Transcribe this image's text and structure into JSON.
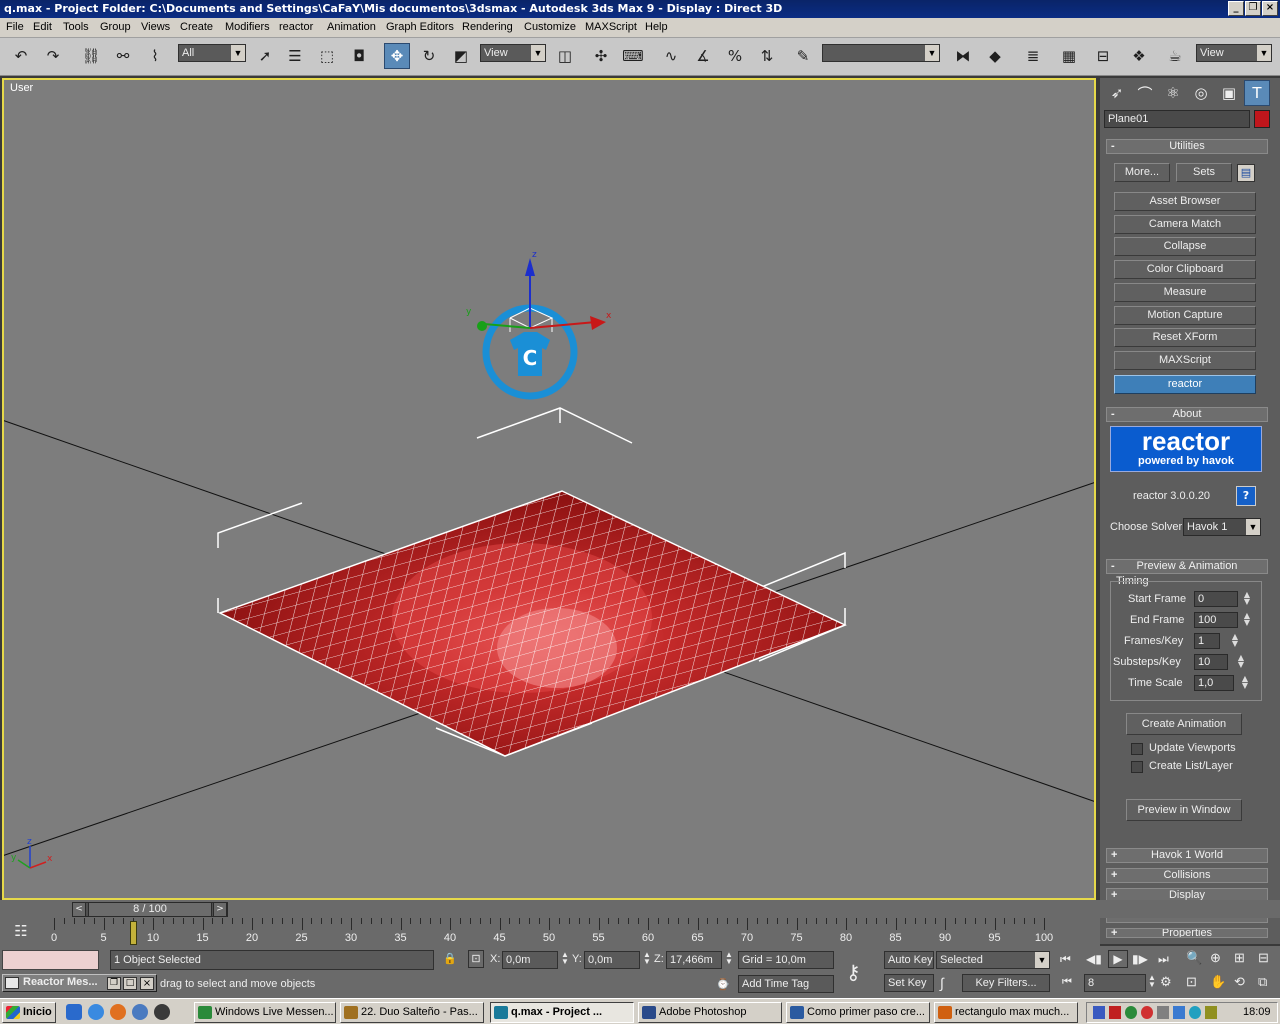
{
  "window": {
    "title": "q.max     - Project Folder: C:\\Documents and Settings\\CaFaY\\Mis documentos\\3dsmax     - Autodesk 3ds Max 9     - Display : Direct 3D"
  },
  "menu": [
    "File",
    "Edit",
    "Tools",
    "Group",
    "Views",
    "Create",
    "Modifiers",
    "reactor",
    "Animation",
    "Graph Editors",
    "Rendering",
    "Customize",
    "MAXScript",
    "Help"
  ],
  "toolbar": {
    "selection_filter": "All",
    "ref_coord": "View",
    "named_selection": "",
    "render_type": "View"
  },
  "viewport": {
    "label": "User"
  },
  "command_panel": {
    "object_name": "Plane01",
    "object_color": "#c0161c",
    "utilities": {
      "title": "Utilities",
      "more_label": "More...",
      "sets_label": "Sets",
      "buttons": [
        "Asset Browser",
        "Camera Match",
        "Collapse",
        "Color Clipboard",
        "Measure",
        "Motion Capture",
        "Reset XForm",
        "MAXScript",
        "reactor"
      ]
    },
    "about": {
      "title": "About",
      "logo_text": "reactor",
      "logo_sub": "powered by havok",
      "version": "reactor 3.0.0.20",
      "help_label": "?",
      "solver_label": "Choose Solver:",
      "solver_value": "Havok 1"
    },
    "preview": {
      "title": "Preview & Animation",
      "group": "Timing",
      "start_frame_label": "Start Frame",
      "start_frame": "0",
      "end_frame_label": "End Frame",
      "end_frame": "100",
      "frames_key_label": "Frames/Key",
      "frames_key": "1",
      "substeps_label": "Substeps/Key",
      "substeps": "10",
      "time_scale_label": "Time Scale",
      "time_scale": "1,0",
      "create_animation": "Create Animation",
      "update_viewports": "Update Viewports",
      "create_list_layer": "Create List/Layer",
      "preview_window": "Preview in Window"
    },
    "collapsed_rollouts": [
      "Havok 1 World",
      "Collisions",
      "Display",
      "Utils",
      "Properties"
    ]
  },
  "timeline": {
    "slider_label": "8 / 100",
    "current_frame": 8,
    "ticks": [
      "0",
      "5",
      "10",
      "15",
      "20",
      "25",
      "30",
      "35",
      "40",
      "45",
      "50",
      "55",
      "60",
      "65",
      "70",
      "75",
      "80",
      "85",
      "90",
      "95",
      "100"
    ]
  },
  "status": {
    "selection": "1 Object Selected",
    "prompt": "drag to select and move objects",
    "x_label": "X:",
    "x": "0,0m",
    "y_label": "Y:",
    "y": "0,0m",
    "z_label": "Z:",
    "z": "17,466m",
    "grid": "Grid = 10,0m",
    "add_time_tag": "Add Time Tag",
    "auto_key": "Auto Key",
    "set_key": "Set Key",
    "key_mode": "Selected",
    "key_filters": "Key Filters...",
    "frame_field": "8",
    "maxscript_listener": "Reactor Mes..."
  },
  "taskbar": {
    "start": "Inicio",
    "tasks": [
      {
        "label": "Windows Live Messen...",
        "color": "#2a8a3a"
      },
      {
        "label": "22. Duo Salteño - Pas...",
        "color": "#a07020"
      },
      {
        "label": "q.max     - Project ...",
        "color": "#1a7a9a"
      },
      {
        "label": "Adobe Photoshop",
        "color": "#2a4a8a"
      },
      {
        "label": "Como primer paso cre...",
        "color": "#2a5aa0"
      },
      {
        "label": "rectangulo max much...",
        "color": "#d06010"
      }
    ],
    "clock": "18:09"
  }
}
